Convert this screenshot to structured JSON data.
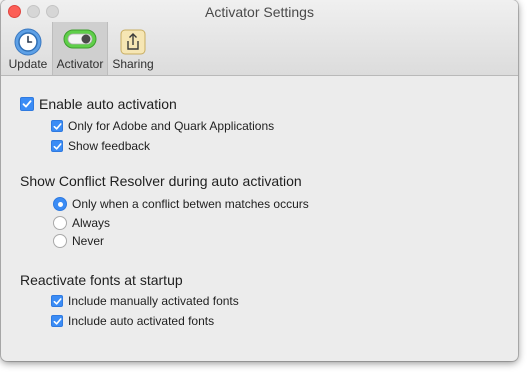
{
  "window": {
    "title": "Activator Settings"
  },
  "tabs": [
    {
      "label": "Update",
      "icon": "clock-icon"
    },
    {
      "label": "Activator",
      "icon": "toggle-switch-icon"
    },
    {
      "label": "Sharing",
      "icon": "share-icon"
    }
  ],
  "selected_tab": "Activator",
  "auto_activation": {
    "enable_label": "Enable auto activation",
    "enable_checked": true,
    "options": [
      {
        "label": "Only for Adobe and Quark Applications",
        "checked": true
      },
      {
        "label": "Show feedback",
        "checked": true
      }
    ]
  },
  "conflict_resolver": {
    "heading": "Show Conflict Resolver during auto activation",
    "options": [
      {
        "label": "Only when a conflict betwen matches occurs",
        "selected": true
      },
      {
        "label": "Always",
        "selected": false
      },
      {
        "label": "Never",
        "selected": false
      }
    ]
  },
  "reactivate": {
    "heading": "Reactivate fonts at startup",
    "options": [
      {
        "label": "Include manually activated fonts",
        "checked": true
      },
      {
        "label": "Include auto activated fonts",
        "checked": true
      }
    ]
  },
  "colors": {
    "accent": "#3b8cf5",
    "close_button": "#fc5f57",
    "toggle_green": "#5fcf49"
  }
}
